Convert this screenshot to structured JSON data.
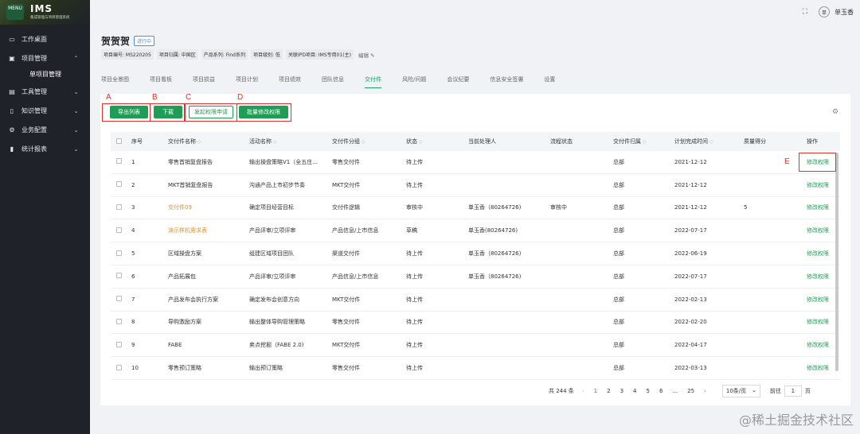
{
  "app": {
    "logo_text": "IMS",
    "logo_sub": "集成管理与项目管理系统",
    "logo_badge": "MENU"
  },
  "sidebar": {
    "items": [
      {
        "label": "工作桌面",
        "icon": "monitor-icon"
      },
      {
        "label": "项目管理",
        "icon": "folder-icon",
        "expanded": true
      },
      {
        "label": "单项目管理",
        "sub": true
      },
      {
        "label": "工具管理",
        "icon": "tools-icon"
      },
      {
        "label": "知识管理",
        "icon": "book-icon"
      },
      {
        "label": "业务配置",
        "icon": "settings-icon"
      },
      {
        "label": "统计报表",
        "icon": "bar-chart-icon"
      }
    ]
  },
  "user": {
    "avatar_text": "单",
    "name": "单玉香"
  },
  "project": {
    "title": "贺贺贺",
    "status": "进行中",
    "meta": [
      "项目编号: MS220205",
      "项目归属: 中国区",
      "产品系列: Find系列",
      "项目级别: 低",
      "关联IPD项目: IMS专用01(主)"
    ],
    "edit_label": "编辑"
  },
  "tabs": [
    "项目全景图",
    "项目看板",
    "项目损益",
    "项目计划",
    "项目绩效",
    "团队信息",
    "交付件",
    "风险/问题",
    "会议纪要",
    "信息安全签署",
    "设置"
  ],
  "active_tab_index": 6,
  "toolbar": {
    "export_label": "导出列表",
    "download_label": "下载",
    "request_perm_label": "发起权限申请",
    "batch_perm_label": "批量修改权限"
  },
  "annotations": {
    "a": "A",
    "b": "B",
    "c": "C",
    "d": "D",
    "e": "E"
  },
  "table": {
    "columns": [
      "序号",
      "交付件名称",
      "活动名称",
      "交付件分组",
      "状态",
      "当前处理人",
      "流程状态",
      "交付件归属",
      "计划完成时间",
      "质量得分",
      "操作"
    ],
    "rows": [
      {
        "no": "1",
        "name": "零售首销复盘报告",
        "act": "输出操盘策略V1（全五庄...",
        "group": "零售交付件",
        "status": "待上传",
        "handler": "",
        "flow": "",
        "scope": "总部",
        "date": "2021-12-12",
        "score": "",
        "op": "修改权限",
        "orange": false
      },
      {
        "no": "2",
        "name": "MKT首销复盘报告",
        "act": "沟通产品上市初步节奏",
        "group": "MKT交付件",
        "status": "待上传",
        "handler": "",
        "flow": "",
        "scope": "总部",
        "date": "2021-12-12",
        "score": "",
        "op": "修改权限",
        "orange": false
      },
      {
        "no": "3",
        "name": "交付件09",
        "act": "确定项目经营目标",
        "group": "交付件逻辑",
        "status": "审核中",
        "handler": "单玉香（80264726)",
        "flow": "审核中",
        "scope": "总部",
        "date": "2021-12-12",
        "score": "5",
        "op": "修改权限",
        "orange": true
      },
      {
        "no": "4",
        "name": "演示样机需求表",
        "act": "产品评审/立项评审",
        "group": "产品信息/上市信息",
        "status": "草稿",
        "handler": "单玉香(80264726)",
        "flow": "",
        "scope": "总部",
        "date": "2022-07-17",
        "score": "",
        "op": "修改权限",
        "orange": true
      },
      {
        "no": "5",
        "name": "区域操盘方案",
        "act": "组建区域项目团队",
        "group": "渠道交付件",
        "status": "待上传",
        "handler": "单玉香（80264726)",
        "flow": "",
        "scope": "总部",
        "date": "2022-06-19",
        "score": "",
        "op": "修改权限",
        "orange": false
      },
      {
        "no": "6",
        "name": "产品拓展包",
        "act": "产品评审/立项评审",
        "group": "产品信息/上市信息",
        "status": "待上传",
        "handler": "单玉香（80264726)",
        "flow": "",
        "scope": "总部",
        "date": "2022-07-17",
        "score": "",
        "op": "修改权限",
        "orange": false
      },
      {
        "no": "7",
        "name": "产品发布会执行方案",
        "act": "确定发布会创意方向",
        "group": "MKT交付件",
        "status": "待上传",
        "handler": "",
        "flow": "",
        "scope": "总部",
        "date": "2022-02-13",
        "score": "",
        "op": "修改权限",
        "orange": false
      },
      {
        "no": "8",
        "name": "导购激励方案",
        "act": "输出整体导购管理策略",
        "group": "零售交付件",
        "status": "待上传",
        "handler": "",
        "flow": "",
        "scope": "总部",
        "date": "2022-02-20",
        "score": "",
        "op": "修改权限",
        "orange": false
      },
      {
        "no": "9",
        "name": "FABE",
        "act": "卖点挖掘（FABE 2.0)",
        "group": "MKT交付件",
        "status": "待上传",
        "handler": "",
        "flow": "",
        "scope": "总部",
        "date": "2022-04-17",
        "score": "",
        "op": "修改权限",
        "orange": false
      },
      {
        "no": "10",
        "name": "零售预订策略",
        "act": "输出预订策略",
        "group": "零售交付件",
        "status": "待上传",
        "handler": "",
        "flow": "",
        "scope": "总部",
        "date": "2022-03-13",
        "score": "",
        "op": "修改权限",
        "orange": false
      }
    ]
  },
  "pagination": {
    "total": "共 244 条",
    "pages": [
      "1",
      "2",
      "3",
      "4",
      "5",
      "6",
      "...",
      "25"
    ],
    "current": "1",
    "page_size": "10条/页",
    "goto_label": "前往",
    "goto_value": "1",
    "page_unit": "页"
  },
  "watermark": "@稀土掘金技术社区"
}
